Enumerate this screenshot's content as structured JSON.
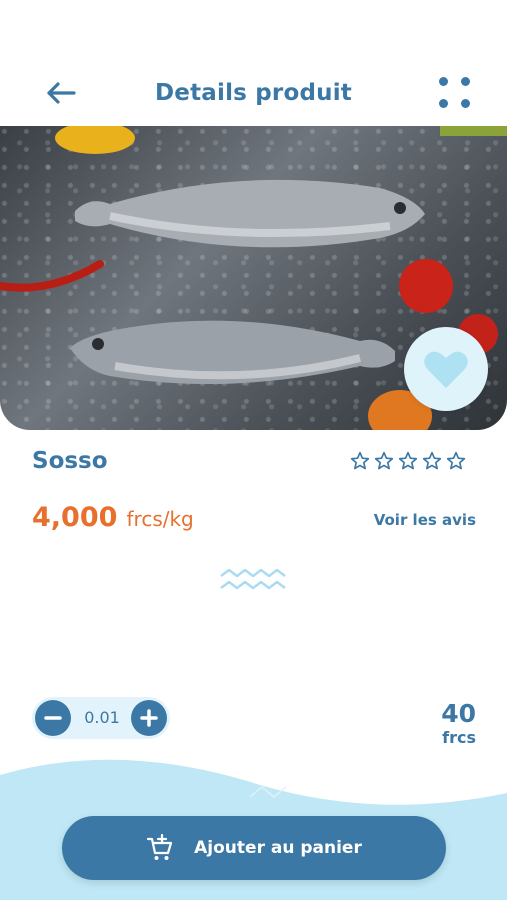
{
  "header": {
    "title": "Details produit",
    "back_icon": "arrow-left-icon",
    "menu_icon": "grid-dots-icon"
  },
  "product": {
    "image_description": "two sea bass on crushed ice with red pepper and tomatoes",
    "favorite_icon": "heart-icon",
    "name": "Sosso",
    "rating_max": 5,
    "rating": 0,
    "price_value": "4,000",
    "price_unit": "frcs/kg",
    "reviews_link": "Voir les avis"
  },
  "order": {
    "quantity": "0.01",
    "minus_icon": "minus-icon",
    "plus_icon": "plus-icon",
    "total_value": "40",
    "total_unit": "frcs"
  },
  "cart": {
    "label": "Ajouter au panier",
    "icon": "cart-plus-icon"
  },
  "colors": {
    "primary": "#3c78a6",
    "accent": "#e8702f",
    "light": "#e3f3fb",
    "wave": "#bfe7f5"
  }
}
